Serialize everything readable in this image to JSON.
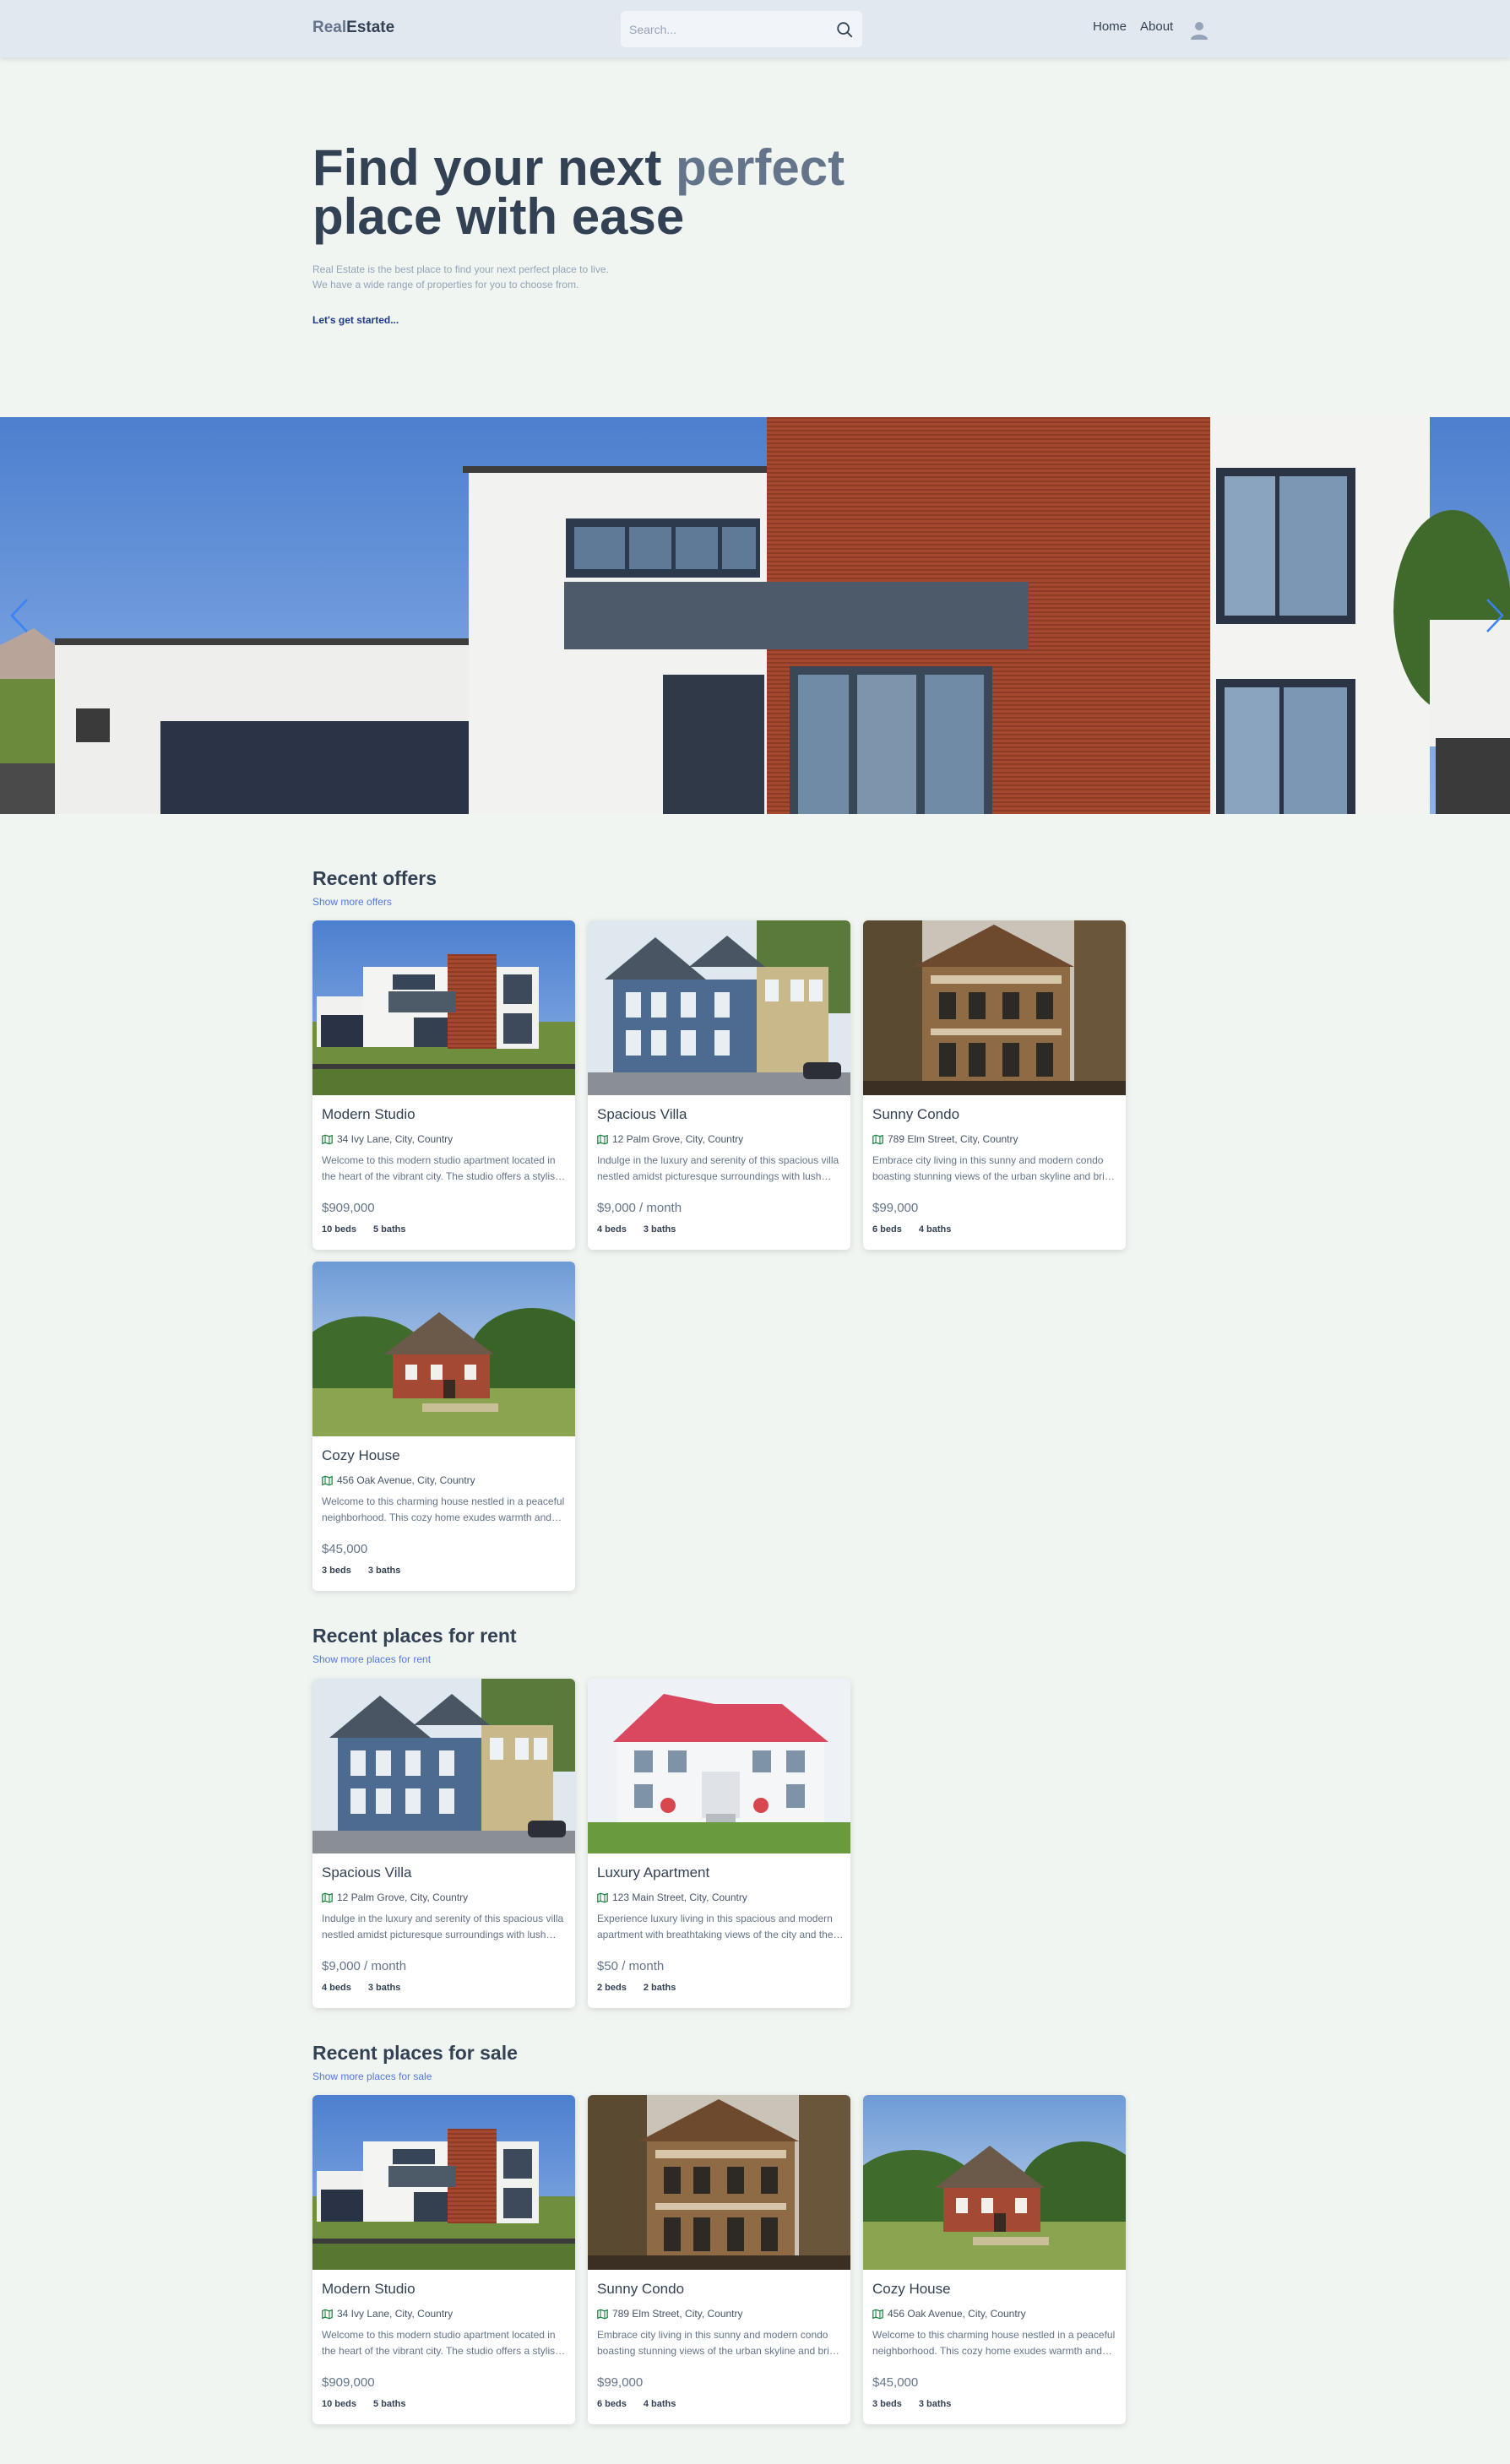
{
  "header": {
    "logo_part1": "Real",
    "logo_part2": "Estate",
    "search_placeholder": "Search...",
    "nav": [
      "Home",
      "About"
    ]
  },
  "hero": {
    "title_part1": "Find your next ",
    "title_highlight": "perfect",
    "title_part2": "place with ease",
    "subtitle_line1": "Real Estate is the best place to find your next perfect place to live.",
    "subtitle_line2": "We have a wide range of properties for you to choose from.",
    "cta": "Let's get started..."
  },
  "icons": {
    "search": "search-icon",
    "avatar": "user-avatar-icon",
    "location": "map-icon",
    "slider_prev": "chevron-left-icon",
    "slider_next": "chevron-right-icon"
  },
  "colors": {
    "accent": "#1e3a8a",
    "link": "#1d4ed8",
    "map_icon": "#15803d"
  },
  "sections": {
    "offers": {
      "title": "Recent offers",
      "link": "Show more offers",
      "listings": [
        {
          "title": "Modern Studio",
          "address": "34 Ivy Lane, City, Country",
          "description": "Welcome to this modern studio apartment located in the heart of the vibrant city. The studio offers a stylish living space.",
          "price": "$909,000",
          "beds": "10 beds",
          "baths": "5 baths"
        },
        {
          "title": "Spacious Villa",
          "address": "12 Palm Grove, City, Country",
          "description": "Indulge in the luxury and serenity of this spacious villa nestled amidst picturesque surroundings with lush gardens.",
          "price": "$9,000 / month",
          "beds": "4 beds",
          "baths": "3 baths"
        },
        {
          "title": "Sunny Condo",
          "address": "789 Elm Street, City, Country",
          "description": "Embrace city living in this sunny and modern condo boasting stunning views of the urban skyline and bright interiors.",
          "price": "$99,000",
          "beds": "6 beds",
          "baths": "4 baths"
        },
        {
          "title": "Cozy House",
          "address": "456 Oak Avenue, City, Country",
          "description": "Welcome to this charming house nestled in a peaceful neighborhood. This cozy home exudes warmth and comfort.",
          "price": "$45,000",
          "beds": "3 beds",
          "baths": "3 baths"
        }
      ]
    },
    "rent": {
      "title": "Recent places for rent",
      "link": "Show more places for rent",
      "listings": [
        {
          "title": "Spacious Villa",
          "address": "12 Palm Grove, City, Country",
          "description": "Indulge in the luxury and serenity of this spacious villa nestled amidst picturesque surroundings with lush gardens.",
          "price": "$9,000 / month",
          "beds": "4 beds",
          "baths": "3 baths"
        },
        {
          "title": "Luxury Apartment",
          "address": "123 Main Street, City, Country",
          "description": "Experience luxury living in this spacious and modern apartment with breathtaking views of the city and the coast.",
          "price": "$50 / month",
          "beds": "2 beds",
          "baths": "2 baths"
        }
      ]
    },
    "sale": {
      "title": "Recent places for sale",
      "link": "Show more places for sale",
      "listings": [
        {
          "title": "Modern Studio",
          "address": "34 Ivy Lane, City, Country",
          "description": "Welcome to this modern studio apartment located in the heart of the vibrant city. The studio offers a stylish living space.",
          "price": "$909,000",
          "beds": "10 beds",
          "baths": "5 baths"
        },
        {
          "title": "Sunny Condo",
          "address": "789 Elm Street, City, Country",
          "description": "Embrace city living in this sunny and modern condo boasting stunning views of the urban skyline and bright interiors.",
          "price": "$99,000",
          "beds": "6 beds",
          "baths": "4 baths"
        },
        {
          "title": "Cozy House",
          "address": "456 Oak Avenue, City, Country",
          "description": "Welcome to this charming house nestled in a peaceful neighborhood. This cozy home exudes warmth and comfort.",
          "price": "$45,000",
          "beds": "3 beds",
          "baths": "3 baths"
        }
      ]
    }
  }
}
